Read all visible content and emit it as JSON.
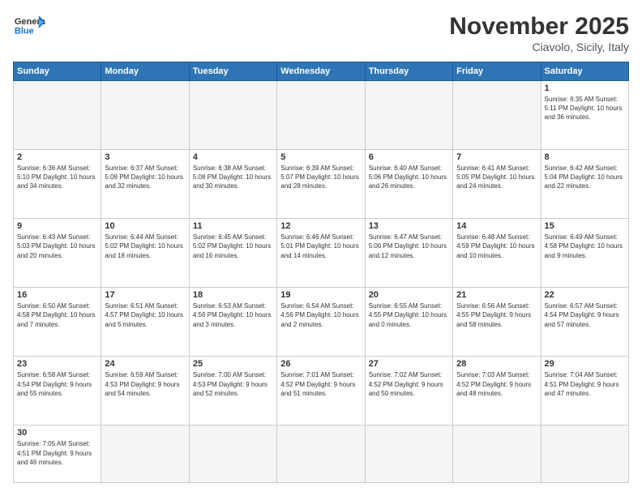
{
  "header": {
    "logo_general": "General",
    "logo_blue": "Blue",
    "month_title": "November 2025",
    "location": "Ciavolo, Sicily, Italy"
  },
  "days_of_week": [
    "Sunday",
    "Monday",
    "Tuesday",
    "Wednesday",
    "Thursday",
    "Friday",
    "Saturday"
  ],
  "weeks": [
    [
      {
        "day": "",
        "info": ""
      },
      {
        "day": "",
        "info": ""
      },
      {
        "day": "",
        "info": ""
      },
      {
        "day": "",
        "info": ""
      },
      {
        "day": "",
        "info": ""
      },
      {
        "day": "",
        "info": ""
      },
      {
        "day": "1",
        "info": "Sunrise: 6:35 AM\nSunset: 5:11 PM\nDaylight: 10 hours and 36 minutes."
      }
    ],
    [
      {
        "day": "2",
        "info": "Sunrise: 6:36 AM\nSunset: 5:10 PM\nDaylight: 10 hours and 34 minutes."
      },
      {
        "day": "3",
        "info": "Sunrise: 6:37 AM\nSunset: 5:09 PM\nDaylight: 10 hours and 32 minutes."
      },
      {
        "day": "4",
        "info": "Sunrise: 6:38 AM\nSunset: 5:08 PM\nDaylight: 10 hours and 30 minutes."
      },
      {
        "day": "5",
        "info": "Sunrise: 6:39 AM\nSunset: 5:07 PM\nDaylight: 10 hours and 28 minutes."
      },
      {
        "day": "6",
        "info": "Sunrise: 6:40 AM\nSunset: 5:06 PM\nDaylight: 10 hours and 26 minutes."
      },
      {
        "day": "7",
        "info": "Sunrise: 6:41 AM\nSunset: 5:05 PM\nDaylight: 10 hours and 24 minutes."
      },
      {
        "day": "8",
        "info": "Sunrise: 6:42 AM\nSunset: 5:04 PM\nDaylight: 10 hours and 22 minutes."
      }
    ],
    [
      {
        "day": "9",
        "info": "Sunrise: 6:43 AM\nSunset: 5:03 PM\nDaylight: 10 hours and 20 minutes."
      },
      {
        "day": "10",
        "info": "Sunrise: 6:44 AM\nSunset: 5:02 PM\nDaylight: 10 hours and 18 minutes."
      },
      {
        "day": "11",
        "info": "Sunrise: 6:45 AM\nSunset: 5:02 PM\nDaylight: 10 hours and 16 minutes."
      },
      {
        "day": "12",
        "info": "Sunrise: 6:46 AM\nSunset: 5:01 PM\nDaylight: 10 hours and 14 minutes."
      },
      {
        "day": "13",
        "info": "Sunrise: 6:47 AM\nSunset: 5:00 PM\nDaylight: 10 hours and 12 minutes."
      },
      {
        "day": "14",
        "info": "Sunrise: 6:48 AM\nSunset: 4:59 PM\nDaylight: 10 hours and 10 minutes."
      },
      {
        "day": "15",
        "info": "Sunrise: 6:49 AM\nSunset: 4:58 PM\nDaylight: 10 hours and 9 minutes."
      }
    ],
    [
      {
        "day": "16",
        "info": "Sunrise: 6:50 AM\nSunset: 4:58 PM\nDaylight: 10 hours and 7 minutes."
      },
      {
        "day": "17",
        "info": "Sunrise: 6:51 AM\nSunset: 4:57 PM\nDaylight: 10 hours and 5 minutes."
      },
      {
        "day": "18",
        "info": "Sunrise: 6:53 AM\nSunset: 4:56 PM\nDaylight: 10 hours and 3 minutes."
      },
      {
        "day": "19",
        "info": "Sunrise: 6:54 AM\nSunset: 4:56 PM\nDaylight: 10 hours and 2 minutes."
      },
      {
        "day": "20",
        "info": "Sunrise: 6:55 AM\nSunset: 4:55 PM\nDaylight: 10 hours and 0 minutes."
      },
      {
        "day": "21",
        "info": "Sunrise: 6:56 AM\nSunset: 4:55 PM\nDaylight: 9 hours and 58 minutes."
      },
      {
        "day": "22",
        "info": "Sunrise: 6:57 AM\nSunset: 4:54 PM\nDaylight: 9 hours and 57 minutes."
      }
    ],
    [
      {
        "day": "23",
        "info": "Sunrise: 6:58 AM\nSunset: 4:54 PM\nDaylight: 9 hours and 55 minutes."
      },
      {
        "day": "24",
        "info": "Sunrise: 6:59 AM\nSunset: 4:53 PM\nDaylight: 9 hours and 54 minutes."
      },
      {
        "day": "25",
        "info": "Sunrise: 7:00 AM\nSunset: 4:53 PM\nDaylight: 9 hours and 52 minutes."
      },
      {
        "day": "26",
        "info": "Sunrise: 7:01 AM\nSunset: 4:52 PM\nDaylight: 9 hours and 51 minutes."
      },
      {
        "day": "27",
        "info": "Sunrise: 7:02 AM\nSunset: 4:52 PM\nDaylight: 9 hours and 50 minutes."
      },
      {
        "day": "28",
        "info": "Sunrise: 7:03 AM\nSunset: 4:52 PM\nDaylight: 9 hours and 48 minutes."
      },
      {
        "day": "29",
        "info": "Sunrise: 7:04 AM\nSunset: 4:51 PM\nDaylight: 9 hours and 47 minutes."
      }
    ],
    [
      {
        "day": "30",
        "info": "Sunrise: 7:05 AM\nSunset: 4:51 PM\nDaylight: 9 hours and 46 minutes."
      },
      {
        "day": "",
        "info": ""
      },
      {
        "day": "",
        "info": ""
      },
      {
        "day": "",
        "info": ""
      },
      {
        "day": "",
        "info": ""
      },
      {
        "day": "",
        "info": ""
      },
      {
        "day": "",
        "info": ""
      }
    ]
  ]
}
